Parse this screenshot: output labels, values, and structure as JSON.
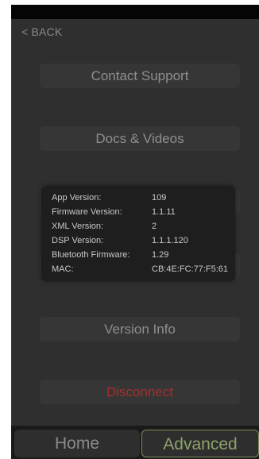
{
  "header": {
    "back_label": "< BACK"
  },
  "menu": {
    "contact_support": "Contact Support",
    "docs_videos": "Docs & Videos",
    "version_info": "Version Info",
    "disconnect": "Disconnect"
  },
  "version_popup": {
    "rows": [
      {
        "label": "App Version:",
        "value": "109"
      },
      {
        "label": "Firmware Version:",
        "value": "1.1.11"
      },
      {
        "label": "XML Version:",
        "value": "2"
      },
      {
        "label": "DSP Version:",
        "value": "1.1.1.120"
      },
      {
        "label": "Bluetooth Firmware:",
        "value": "1.29"
      },
      {
        "label": "MAC:",
        "value": "CB:4E:FC:77:F5:61"
      }
    ]
  },
  "tabs": {
    "home": "Home",
    "advanced": "Advanced",
    "active": "advanced"
  },
  "colors": {
    "panel_bg": "#2f2f2f",
    "button_bg": "#363636",
    "popup_bg": "#1e1e1e",
    "danger": "#a3312c",
    "accent_green": "#8da26a"
  }
}
